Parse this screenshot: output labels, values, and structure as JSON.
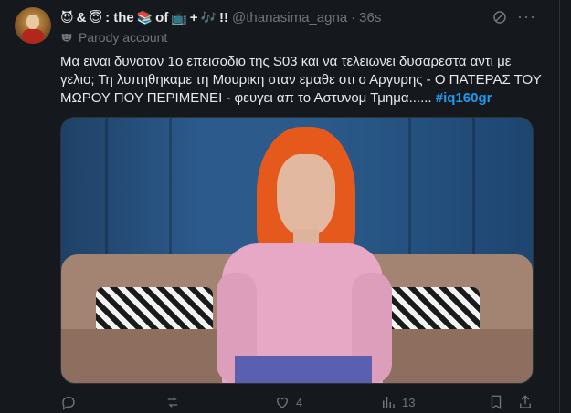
{
  "post": {
    "display_name": ": the  of +!!",
    "name_parts": {
      "amp": "&",
      "colon_the": ": the",
      "of": "of",
      "plus": "+",
      "bang": "!!"
    },
    "name_emojis": {
      "devil": "😈",
      "angel": "😇",
      "books": "📚",
      "tv": "📺",
      "music": "🎶"
    },
    "handle": "@thanasima_agna",
    "separator": "·",
    "time": "36s",
    "parody_label": "Parody account",
    "text_main": "Μα ειναι δυνατον 1ο επεισοδιο της S03 και να τελειωνει δυσαρεστα αντι με γελιο; Τη λυπηθηκαμε τη Μουρικη οταν εμαθε οτι ο Αργυρης - Ο ΠΑΤΕΡΑΣ ΤΟΥ ΜΩΡΟΥ ΠΟΥ ΠΕΡΙΜΕΝΕΙ - φευγει απ το Αστυνομ Τμημα......",
    "hashtag": "#iq160gr",
    "more_glyph": "···",
    "accent_color": "#1d9bf0",
    "icons": {
      "grok": "grok-icon",
      "more": "more-icon",
      "reply": "reply-icon",
      "repost": "repost-icon",
      "like": "like-icon",
      "views": "views-icon",
      "bookmark": "bookmark-icon",
      "share": "share-icon"
    }
  },
  "actions": {
    "likes": "4",
    "views": "13"
  }
}
